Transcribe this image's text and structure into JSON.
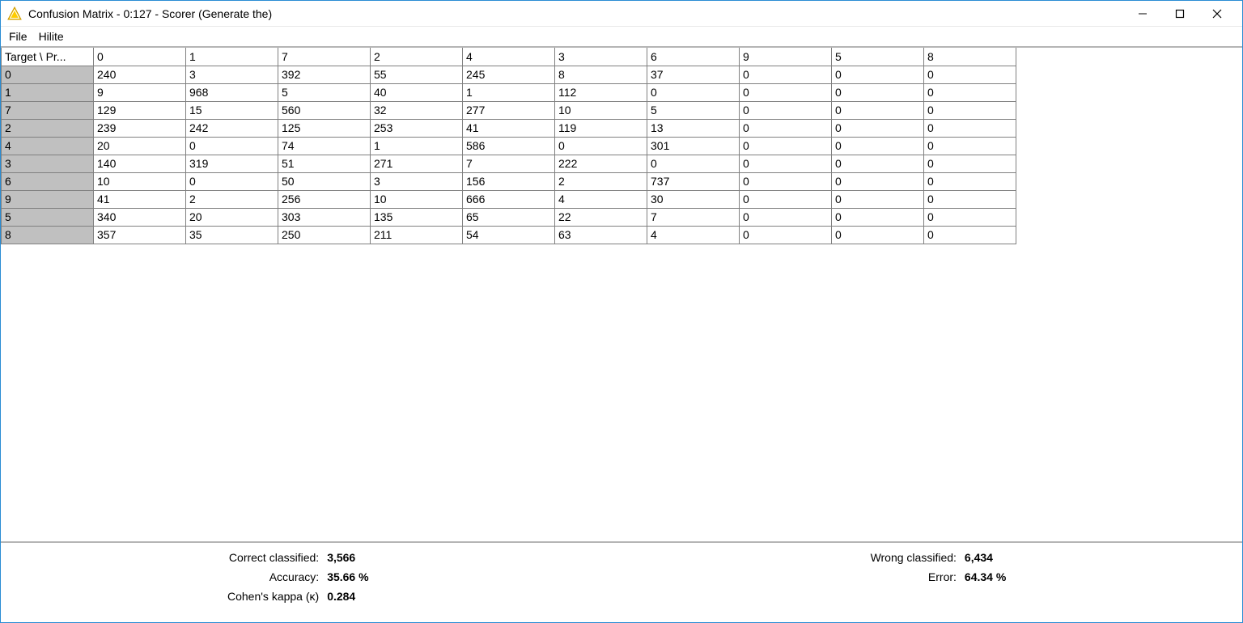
{
  "window": {
    "title": "Confusion Matrix - 0:127 - Scorer (Generate the)"
  },
  "menu": {
    "items": [
      "File",
      "Hilite"
    ]
  },
  "matrix": {
    "corner_label": "Target \\ Pr...",
    "column_headers": [
      "0",
      "1",
      "7",
      "2",
      "4",
      "3",
      "6",
      "9",
      "5",
      "8"
    ],
    "rows": [
      {
        "label": "0",
        "cells": [
          "240",
          "3",
          "392",
          "55",
          "245",
          "8",
          "37",
          "0",
          "0",
          "0"
        ]
      },
      {
        "label": "1",
        "cells": [
          "9",
          "968",
          "5",
          "40",
          "1",
          "112",
          "0",
          "0",
          "0",
          "0"
        ]
      },
      {
        "label": "7",
        "cells": [
          "129",
          "15",
          "560",
          "32",
          "277",
          "10",
          "5",
          "0",
          "0",
          "0"
        ]
      },
      {
        "label": "2",
        "cells": [
          "239",
          "242",
          "125",
          "253",
          "41",
          "119",
          "13",
          "0",
          "0",
          "0"
        ]
      },
      {
        "label": "4",
        "cells": [
          "20",
          "0",
          "74",
          "1",
          "586",
          "0",
          "301",
          "0",
          "0",
          "0"
        ]
      },
      {
        "label": "3",
        "cells": [
          "140",
          "319",
          "51",
          "271",
          "7",
          "222",
          "0",
          "0",
          "0",
          "0"
        ]
      },
      {
        "label": "6",
        "cells": [
          "10",
          "0",
          "50",
          "3",
          "156",
          "2",
          "737",
          "0",
          "0",
          "0"
        ]
      },
      {
        "label": "9",
        "cells": [
          "41",
          "2",
          "256",
          "10",
          "666",
          "4",
          "30",
          "0",
          "0",
          "0"
        ]
      },
      {
        "label": "5",
        "cells": [
          "340",
          "20",
          "303",
          "135",
          "65",
          "22",
          "7",
          "0",
          "0",
          "0"
        ]
      },
      {
        "label": "8",
        "cells": [
          "357",
          "35",
          "250",
          "211",
          "54",
          "63",
          "4",
          "0",
          "0",
          "0"
        ]
      }
    ]
  },
  "stats": {
    "left": [
      {
        "label": "Correct classified:",
        "value": "3,566"
      },
      {
        "label": "Accuracy:",
        "value": "35.66 %"
      },
      {
        "label": "Cohen's kappa (κ)",
        "value": "0.284"
      }
    ],
    "right": [
      {
        "label": "Wrong classified:",
        "value": "6,434"
      },
      {
        "label": "Error:",
        "value": "64.34 %"
      }
    ]
  }
}
